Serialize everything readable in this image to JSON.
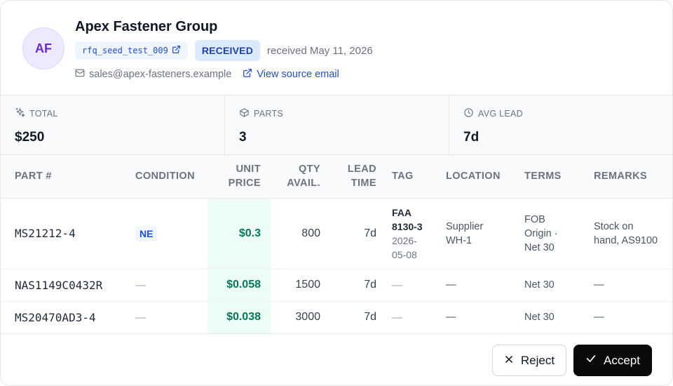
{
  "vendor": {
    "initials": "AF",
    "name": "Apex Fastener Group",
    "rfq_id": "rfq_seed_test_009",
    "status": "RECEIVED",
    "received_text": "received May 11, 2026",
    "email": "sales@apex-fasteners.example",
    "source_link": "View source email"
  },
  "stats": {
    "total_label": "TOTAL",
    "total_value": "$250",
    "parts_label": "PARTS",
    "parts_value": "3",
    "lead_label": "AVG LEAD",
    "lead_value": "7d"
  },
  "table": {
    "headers": {
      "part": "PART #",
      "condition": "CONDITION",
      "unit_price_1": "UNIT",
      "unit_price_2": "PRICE",
      "qty_1": "QTY",
      "qty_2": "AVAIL.",
      "lead_1": "LEAD",
      "lead_2": "TIME",
      "tag": "TAG",
      "location": "LOCATION",
      "terms": "TERMS",
      "remarks": "REMARKS"
    },
    "rows": [
      {
        "part": "MS21212-4",
        "condition": "NE",
        "unit_price": "$0.3",
        "qty": "800",
        "lead": "7d",
        "tag_line1": "FAA",
        "tag_line2": "8130-3",
        "tag_date_line1": "2026-",
        "tag_date_line2": "05-08",
        "location_line1": "Supplier",
        "location_line2": "WH-1",
        "terms_line1": "FOB",
        "terms_line2": "Origin ·",
        "terms_line3": "Net 30",
        "remarks_line1": "Stock on",
        "remarks_line2": "hand, AS9100"
      },
      {
        "part": "NAS1149C0432R",
        "condition": "—",
        "unit_price": "$0.058",
        "qty": "1500",
        "lead": "7d",
        "tag": "—",
        "location": "—",
        "terms": "Net 30",
        "remarks": "—"
      },
      {
        "part": "MS20470AD3-4",
        "condition": "—",
        "unit_price": "$0.038",
        "qty": "3000",
        "lead": "7d",
        "tag": "—",
        "location": "—",
        "terms": "Net 30",
        "remarks": "—"
      }
    ]
  },
  "actions": {
    "reject": "Reject",
    "accept": "Accept"
  },
  "icons": {
    "external_link": "external-link-icon",
    "mail": "mail-icon",
    "sparkle": "sparkle-icon",
    "box": "box-icon",
    "clock": "clock-icon",
    "close": "close-icon",
    "check": "check-icon"
  },
  "colors": {
    "accent": "#1d4ed8",
    "price_bg": "#ecfdf5",
    "price_text": "#047857",
    "avatar_bg": "#ede9fe",
    "accept_bg": "#0a0a0a"
  }
}
